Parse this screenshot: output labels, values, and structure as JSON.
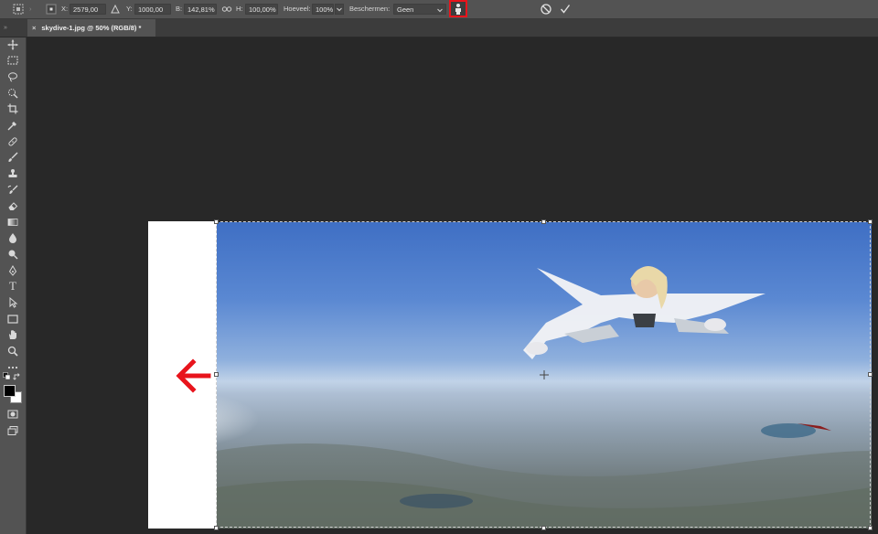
{
  "options_bar": {
    "x_label": "X:",
    "x_value": "2579,00 px",
    "y_label": "Y:",
    "y_value": "1000,00 px",
    "w_label": "B:",
    "w_value": "142,81%",
    "h_label": "H:",
    "h_value": "100,00%",
    "amount_label": "Hoeveel:",
    "amount_value": "100%",
    "protect_label": "Beschermen:",
    "protect_value": "Geen",
    "protect_skin_active": true,
    "highlight_color": "#e8141c"
  },
  "document_tab": {
    "close_symbol": "×",
    "title": "skydive-1.jpg @ 50% (RGB/8) *"
  },
  "toolbar": {
    "tools": [
      "move-tool",
      "rect-marquee-tool",
      "lasso-tool",
      "quick-selection-tool",
      "crop-tool",
      "eyedropper-tool",
      "healing-brush-tool",
      "brush-tool",
      "clone-stamp-tool",
      "history-brush-tool",
      "eraser-tool",
      "gradient-tool",
      "blur-tool",
      "dodge-tool",
      "pen-tool",
      "type-tool",
      "path-selection-tool",
      "rectangle-tool",
      "hand-tool",
      "zoom-tool",
      "more-tools"
    ],
    "type_tool_glyph": "T",
    "foreground_color": "#000000",
    "background_color": "#ffffff"
  },
  "canvas": {
    "annotation_arrow_color": "#e8141c",
    "new_area_color": "#ffffff"
  }
}
